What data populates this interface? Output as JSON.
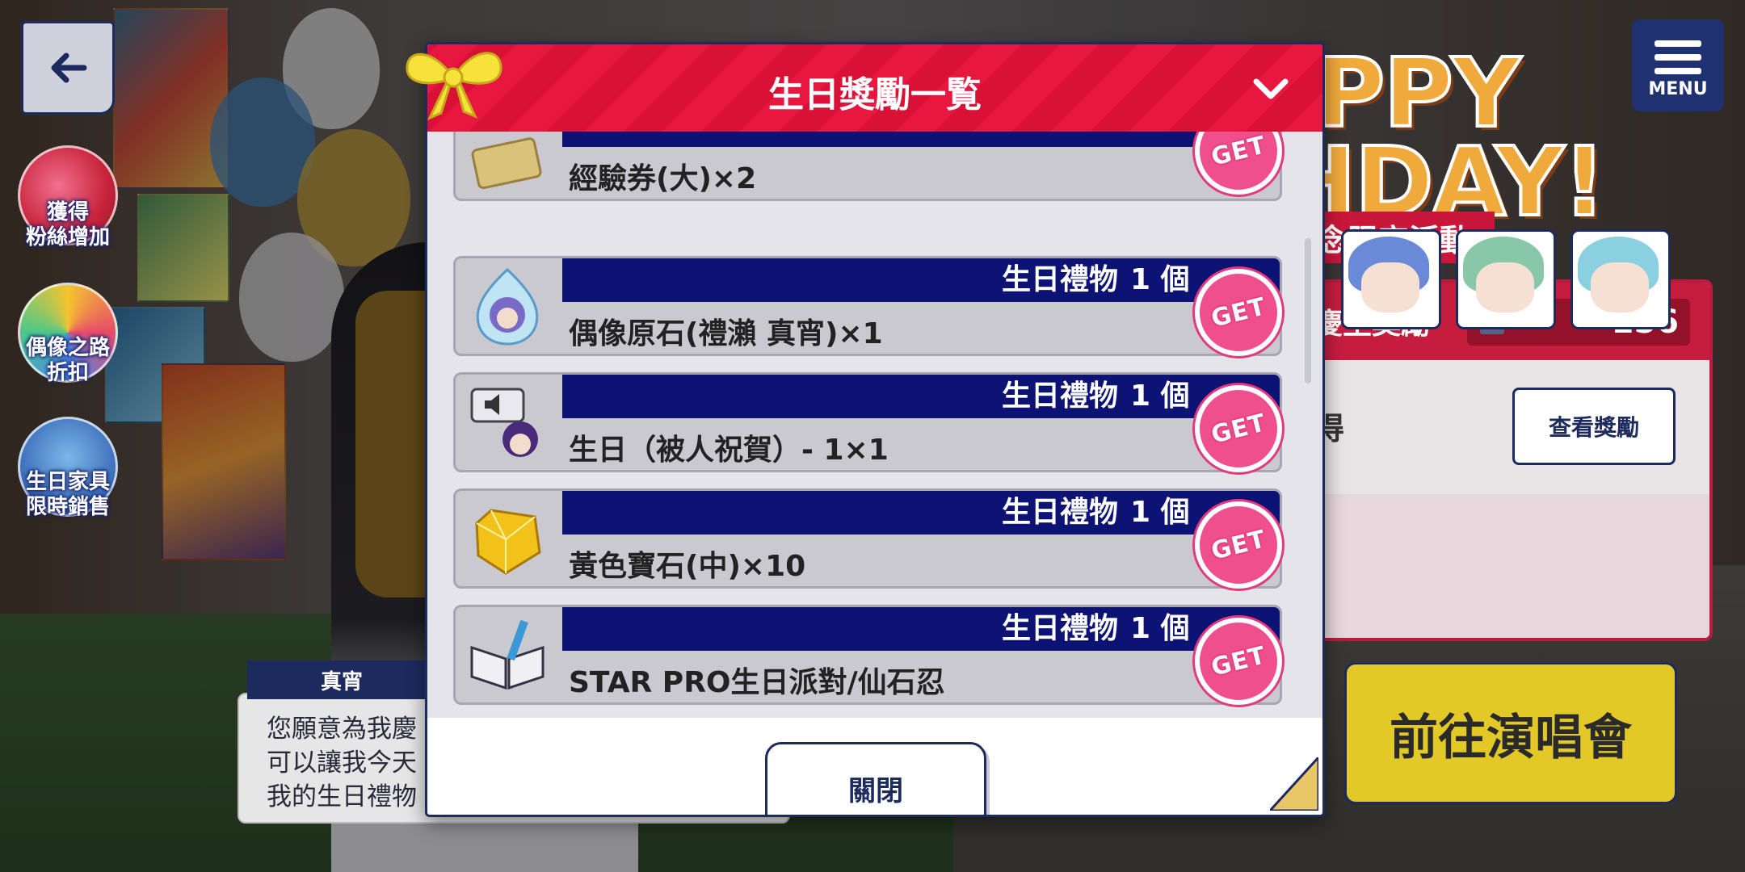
{
  "colors": {
    "navy": "#1d2a5e",
    "header_red": "#e8173f",
    "band_navy": "#0d1275",
    "get_pink": "#f04f8e",
    "concert_yellow": "#e3c928"
  },
  "nav": {
    "back_icon": "arrow-left-icon",
    "menu_label": "MENU"
  },
  "side_buttons": [
    {
      "label": "獲得\n粉絲增加",
      "icon": "heart-key-icon"
    },
    {
      "label": "偶像之路\n折扣",
      "icon": "gem-star-icon"
    },
    {
      "label": "生日家具\n限時銷售",
      "icon": "building-icon"
    }
  ],
  "background": {
    "title_line1": "PPY",
    "title_line2": "HDAY!",
    "event_banner": "念限定活動",
    "reward_panel_title": "慶生獎勵",
    "reward_count": "156",
    "obtain_text": "得",
    "view_rewards_button": "查看獎勵",
    "concert_button": "前往演唱會"
  },
  "dialogue": {
    "speaker": "真宵",
    "lines": "您願意為我慶\n可以讓我今天\n我的生日禮物"
  },
  "modal": {
    "title": "生日獎勵一覧",
    "collapse_icon": "chevron-down-icon",
    "close_button": "關閉",
    "items": [
      {
        "category": "",
        "quantity": "",
        "name": "經驗券(大)×2",
        "icon": "ticket-icon",
        "badge": "GET"
      },
      {
        "category": "生日禮物",
        "quantity": "1 個",
        "name": "偶像原石(禮瀨 真宵)×1",
        "icon": "idol-stone-icon",
        "badge": "GET"
      },
      {
        "category": "生日禮物",
        "quantity": "1 個",
        "name": "生日（被人祝賀）- 1×1",
        "icon": "voice-icon",
        "badge": "GET"
      },
      {
        "category": "生日禮物",
        "quantity": "1 個",
        "name": "黃色寶石(中)×10",
        "icon": "yellow-gem-icon",
        "badge": "GET"
      },
      {
        "category": "生日禮物",
        "quantity": "1 個",
        "name": "STAR PRO生日派對/仙石忍",
        "icon": "book-icon",
        "badge": "GET"
      }
    ]
  }
}
